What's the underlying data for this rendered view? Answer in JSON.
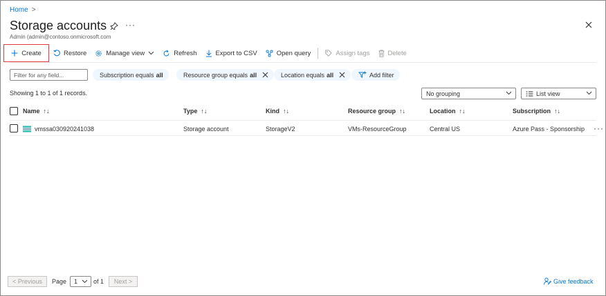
{
  "breadcrumb": {
    "home": "Home",
    "separator": ">"
  },
  "header": {
    "title": "Storage accounts",
    "subtitle": "Admin (admin@contoso.onmicrosoft.com",
    "more": "···"
  },
  "toolbar": {
    "create": "Create",
    "restore": "Restore",
    "manage_view": "Manage view",
    "refresh": "Refresh",
    "export_csv": "Export to CSV",
    "open_query": "Open query",
    "assign_tags": "Assign tags",
    "delete": "Delete"
  },
  "filters": {
    "placeholder": "Filter for any field...",
    "pills": [
      {
        "label": "Subscription equals",
        "value": "all"
      },
      {
        "label": "Resource group equals",
        "value": "all"
      },
      {
        "label": "Location equals",
        "value": "all"
      }
    ],
    "add_filter": "Add filter"
  },
  "records_text": "Showing 1 to 1 of 1 records.",
  "grouping": {
    "selected": "No grouping"
  },
  "view": {
    "selected": "List view"
  },
  "table": {
    "columns": [
      "Name",
      "Type",
      "Kind",
      "Resource group",
      "Location",
      "Subscription"
    ],
    "sort_glyph": "↑↓",
    "rows": [
      {
        "name": "vmssa030920241038",
        "type": "Storage account",
        "kind": "StorageV2",
        "resource_group": "VMs-ResourceGroup",
        "location": "Central US",
        "subscription": "Azure Pass - Sponsorship",
        "more": "···"
      }
    ]
  },
  "pager": {
    "previous": "< Previous",
    "page_label": "Page",
    "current_page": "1",
    "of_label": "of 1",
    "next": "Next >"
  },
  "feedback": "Give feedback",
  "colors": {
    "accent": "#0078d4",
    "pill_bg": "#f0f6fd",
    "create_border": "#e0393e"
  }
}
